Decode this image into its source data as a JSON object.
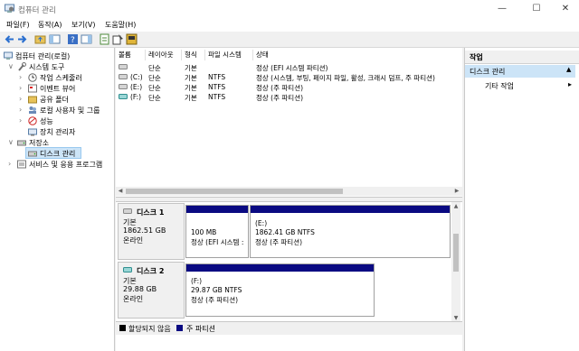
{
  "window": {
    "title": "컴퓨터 관리"
  },
  "menu": [
    "파일(F)",
    "동작(A)",
    "보기(V)",
    "도움말(H)"
  ],
  "tree": {
    "root": "컴퓨터 관리(로컬)",
    "system_tools": "시스템 도구",
    "task_scheduler": "작업 스케줄러",
    "event_viewer": "이벤트 뷰어",
    "shared_folders": "공유 폴더",
    "local_users": "로컬 사용자 및 그룹",
    "performance": "성능",
    "device_manager": "장치 관리자",
    "storage": "저장소",
    "disk_management": "디스크 관리",
    "services": "서비스 및 응용 프로그램"
  },
  "volume_table": {
    "headers": [
      "볼륨",
      "레이아웃",
      "형식",
      "파일 시스템",
      "상태"
    ],
    "rows": [
      {
        "volume": "",
        "layout": "단순",
        "type": "기본",
        "fs": "",
        "status": "정상 (EFI 시스템 파티션)"
      },
      {
        "volume": "(C:)",
        "layout": "단순",
        "type": "기본",
        "fs": "NTFS",
        "status": "정상 (시스템, 부팅, 페이지 파일, 활성, 크래시 덤프, 주 파티션)"
      },
      {
        "volume": "(E:)",
        "layout": "단순",
        "type": "기본",
        "fs": "NTFS",
        "status": "정상 (주 파티션)"
      },
      {
        "volume": "(F:)",
        "layout": "단순",
        "type": "기본",
        "fs": "NTFS",
        "status": "정상 (주 파티션)"
      }
    ]
  },
  "disks": [
    {
      "name": "디스크 1",
      "kind": "기본",
      "size": "1862.51 GB",
      "state": "온라인",
      "partitions": [
        {
          "label": "",
          "line1": "100 MB",
          "line2": "정상 (EFI 시스템 :"
        },
        {
          "label": "(E:)",
          "line1": "1862.41 GB NTFS",
          "line2": "정상 (주 파티션)"
        }
      ]
    },
    {
      "name": "디스크 2",
      "kind": "기본",
      "size": "29.88 GB",
      "state": "온라인",
      "partitions": [
        {
          "label": "(F:)",
          "line1": "29.87 GB NTFS",
          "line2": "정상 (주 파티션)"
        }
      ]
    }
  ],
  "legend": {
    "unallocated": "할당되지 않음",
    "primary": "주 파티션"
  },
  "actions": {
    "header": "작업",
    "section": "디스크 관리",
    "more": "기타 작업"
  },
  "colors": {
    "primary_partition": "#0a0a82",
    "unallocated": "#000000",
    "selection": "#cce4f7"
  }
}
